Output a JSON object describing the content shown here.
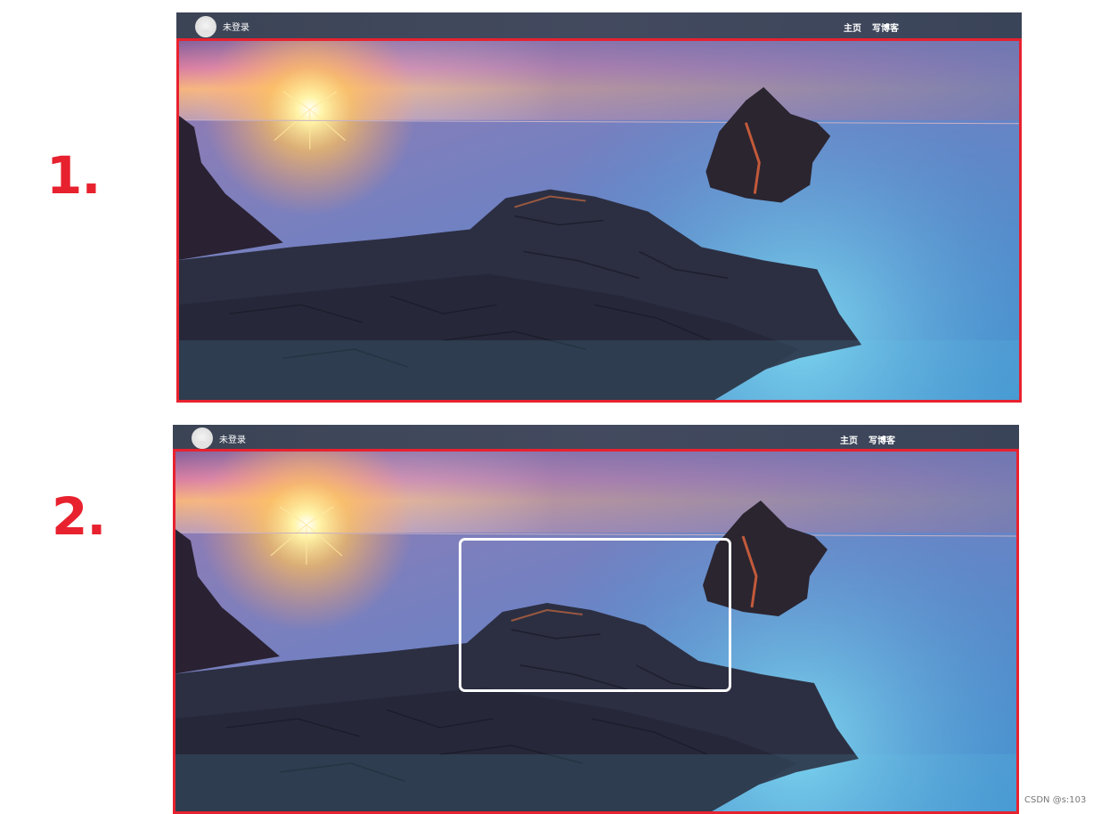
{
  "steps": [
    {
      "number_label": "1.",
      "navbar": {
        "user_status": "未登录",
        "links": [
          "主页",
          "写博客"
        ]
      },
      "has_focus_box": false
    },
    {
      "number_label": "2.",
      "navbar": {
        "user_status": "未登录",
        "links": [
          "主页",
          "写博客"
        ]
      },
      "has_focus_box": true
    }
  ],
  "watermark": "CSDN @s:103",
  "colors": {
    "annotation_red": "#e8212f",
    "navbar_bg": "#3d4659",
    "focus_box": "#ffffff"
  },
  "icons": {
    "avatar": "user-avatar-icon"
  }
}
